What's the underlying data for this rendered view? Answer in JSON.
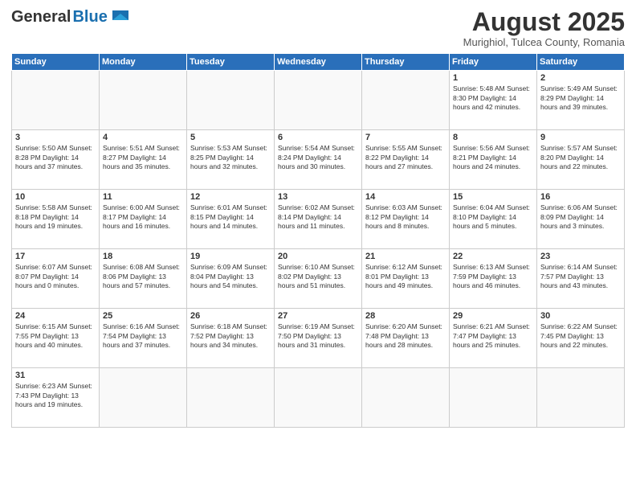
{
  "header": {
    "logo_general": "General",
    "logo_blue": "Blue",
    "month_title": "August 2025",
    "location": "Murighiol, Tulcea County, Romania"
  },
  "weekdays": [
    "Sunday",
    "Monday",
    "Tuesday",
    "Wednesday",
    "Thursday",
    "Friday",
    "Saturday"
  ],
  "weeks": [
    [
      {
        "day": "",
        "info": ""
      },
      {
        "day": "",
        "info": ""
      },
      {
        "day": "",
        "info": ""
      },
      {
        "day": "",
        "info": ""
      },
      {
        "day": "",
        "info": ""
      },
      {
        "day": "1",
        "info": "Sunrise: 5:48 AM\nSunset: 8:30 PM\nDaylight: 14 hours and 42 minutes."
      },
      {
        "day": "2",
        "info": "Sunrise: 5:49 AM\nSunset: 8:29 PM\nDaylight: 14 hours and 39 minutes."
      }
    ],
    [
      {
        "day": "3",
        "info": "Sunrise: 5:50 AM\nSunset: 8:28 PM\nDaylight: 14 hours and 37 minutes."
      },
      {
        "day": "4",
        "info": "Sunrise: 5:51 AM\nSunset: 8:27 PM\nDaylight: 14 hours and 35 minutes."
      },
      {
        "day": "5",
        "info": "Sunrise: 5:53 AM\nSunset: 8:25 PM\nDaylight: 14 hours and 32 minutes."
      },
      {
        "day": "6",
        "info": "Sunrise: 5:54 AM\nSunset: 8:24 PM\nDaylight: 14 hours and 30 minutes."
      },
      {
        "day": "7",
        "info": "Sunrise: 5:55 AM\nSunset: 8:22 PM\nDaylight: 14 hours and 27 minutes."
      },
      {
        "day": "8",
        "info": "Sunrise: 5:56 AM\nSunset: 8:21 PM\nDaylight: 14 hours and 24 minutes."
      },
      {
        "day": "9",
        "info": "Sunrise: 5:57 AM\nSunset: 8:20 PM\nDaylight: 14 hours and 22 minutes."
      }
    ],
    [
      {
        "day": "10",
        "info": "Sunrise: 5:58 AM\nSunset: 8:18 PM\nDaylight: 14 hours and 19 minutes."
      },
      {
        "day": "11",
        "info": "Sunrise: 6:00 AM\nSunset: 8:17 PM\nDaylight: 14 hours and 16 minutes."
      },
      {
        "day": "12",
        "info": "Sunrise: 6:01 AM\nSunset: 8:15 PM\nDaylight: 14 hours and 14 minutes."
      },
      {
        "day": "13",
        "info": "Sunrise: 6:02 AM\nSunset: 8:14 PM\nDaylight: 14 hours and 11 minutes."
      },
      {
        "day": "14",
        "info": "Sunrise: 6:03 AM\nSunset: 8:12 PM\nDaylight: 14 hours and 8 minutes."
      },
      {
        "day": "15",
        "info": "Sunrise: 6:04 AM\nSunset: 8:10 PM\nDaylight: 14 hours and 5 minutes."
      },
      {
        "day": "16",
        "info": "Sunrise: 6:06 AM\nSunset: 8:09 PM\nDaylight: 14 hours and 3 minutes."
      }
    ],
    [
      {
        "day": "17",
        "info": "Sunrise: 6:07 AM\nSunset: 8:07 PM\nDaylight: 14 hours and 0 minutes."
      },
      {
        "day": "18",
        "info": "Sunrise: 6:08 AM\nSunset: 8:06 PM\nDaylight: 13 hours and 57 minutes."
      },
      {
        "day": "19",
        "info": "Sunrise: 6:09 AM\nSunset: 8:04 PM\nDaylight: 13 hours and 54 minutes."
      },
      {
        "day": "20",
        "info": "Sunrise: 6:10 AM\nSunset: 8:02 PM\nDaylight: 13 hours and 51 minutes."
      },
      {
        "day": "21",
        "info": "Sunrise: 6:12 AM\nSunset: 8:01 PM\nDaylight: 13 hours and 49 minutes."
      },
      {
        "day": "22",
        "info": "Sunrise: 6:13 AM\nSunset: 7:59 PM\nDaylight: 13 hours and 46 minutes."
      },
      {
        "day": "23",
        "info": "Sunrise: 6:14 AM\nSunset: 7:57 PM\nDaylight: 13 hours and 43 minutes."
      }
    ],
    [
      {
        "day": "24",
        "info": "Sunrise: 6:15 AM\nSunset: 7:55 PM\nDaylight: 13 hours and 40 minutes."
      },
      {
        "day": "25",
        "info": "Sunrise: 6:16 AM\nSunset: 7:54 PM\nDaylight: 13 hours and 37 minutes."
      },
      {
        "day": "26",
        "info": "Sunrise: 6:18 AM\nSunset: 7:52 PM\nDaylight: 13 hours and 34 minutes."
      },
      {
        "day": "27",
        "info": "Sunrise: 6:19 AM\nSunset: 7:50 PM\nDaylight: 13 hours and 31 minutes."
      },
      {
        "day": "28",
        "info": "Sunrise: 6:20 AM\nSunset: 7:48 PM\nDaylight: 13 hours and 28 minutes."
      },
      {
        "day": "29",
        "info": "Sunrise: 6:21 AM\nSunset: 7:47 PM\nDaylight: 13 hours and 25 minutes."
      },
      {
        "day": "30",
        "info": "Sunrise: 6:22 AM\nSunset: 7:45 PM\nDaylight: 13 hours and 22 minutes."
      }
    ],
    [
      {
        "day": "31",
        "info": "Sunrise: 6:23 AM\nSunset: 7:43 PM\nDaylight: 13 hours and 19 minutes."
      },
      {
        "day": "",
        "info": ""
      },
      {
        "day": "",
        "info": ""
      },
      {
        "day": "",
        "info": ""
      },
      {
        "day": "",
        "info": ""
      },
      {
        "day": "",
        "info": ""
      },
      {
        "day": "",
        "info": ""
      }
    ]
  ]
}
